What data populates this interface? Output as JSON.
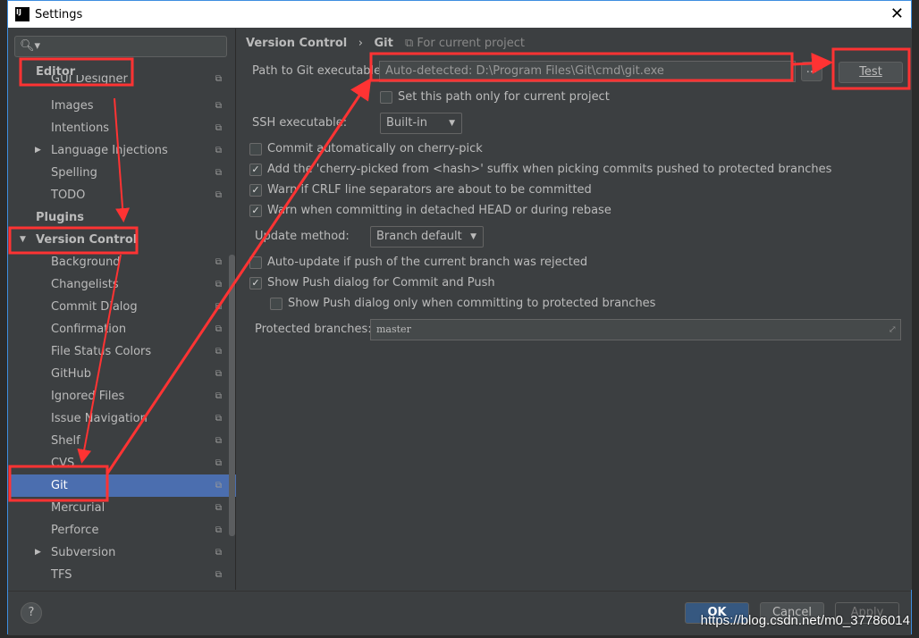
{
  "window": {
    "title": "Settings"
  },
  "sidebar": {
    "search_placeholder": "",
    "items": [
      {
        "label": "Editor",
        "level": 0
      },
      {
        "label": "GUI Designer"
      },
      {
        "label": "Images"
      },
      {
        "label": "Intentions"
      },
      {
        "label": "Language Injections",
        "expandable": true
      },
      {
        "label": "Spelling"
      },
      {
        "label": "TODO"
      },
      {
        "label": "Plugins",
        "level": 0
      },
      {
        "label": "Version Control",
        "level": 0,
        "expanded": true
      },
      {
        "label": "Background"
      },
      {
        "label": "Changelists"
      },
      {
        "label": "Commit Dialog"
      },
      {
        "label": "Confirmation"
      },
      {
        "label": "File Status Colors"
      },
      {
        "label": "GitHub"
      },
      {
        "label": "Ignored Files"
      },
      {
        "label": "Issue Navigation"
      },
      {
        "label": "Shelf"
      },
      {
        "label": "CVS"
      },
      {
        "label": "Git",
        "selected": true
      },
      {
        "label": "Mercurial"
      },
      {
        "label": "Perforce"
      },
      {
        "label": "Subversion",
        "expandable": true
      },
      {
        "label": "TFS"
      }
    ]
  },
  "breadcrumb": {
    "parent": "Version Control",
    "sep": "›",
    "current": "Git",
    "scope": "For current project"
  },
  "git": {
    "path_label": "Path to Git executable:",
    "path_value": "Auto-detected: D:\\Program Files\\Git\\cmd\\git.exe",
    "browse_label": "...",
    "test_label": "Test",
    "current_project_only": {
      "label": "Set this path only for current project",
      "checked": false
    },
    "ssh_label": "SSH executable:",
    "ssh_value": "Built-in",
    "checks": [
      {
        "label": "Commit automatically on cherry-pick",
        "checked": false
      },
      {
        "label": "Add the 'cherry-picked from <hash>' suffix when picking commits pushed to protected branches",
        "checked": true
      },
      {
        "label": "Warn if CRLF line separators are about to be committed",
        "checked": true
      },
      {
        "label": "Warn when committing in detached HEAD or during rebase",
        "checked": true
      }
    ],
    "update_label": "Update method:",
    "update_value": "Branch default",
    "checks2": [
      {
        "label": "Auto-update if push of the current branch was rejected",
        "checked": false
      },
      {
        "label": "Show Push dialog for Commit and Push",
        "checked": true
      },
      {
        "label": "Show Push dialog only when committing to protected branches",
        "checked": false
      }
    ],
    "protected_label": "Protected branches:",
    "protected_value": "master"
  },
  "footer": {
    "help": "?",
    "ok": "OK",
    "cancel": "Cancel",
    "apply": "Apply"
  },
  "watermark": "https://blog.csdn.net/m0_37786014",
  "colors": {
    "selection": "#4b6eaf",
    "annotation": "#ff3333",
    "background": "#3c3f41"
  }
}
